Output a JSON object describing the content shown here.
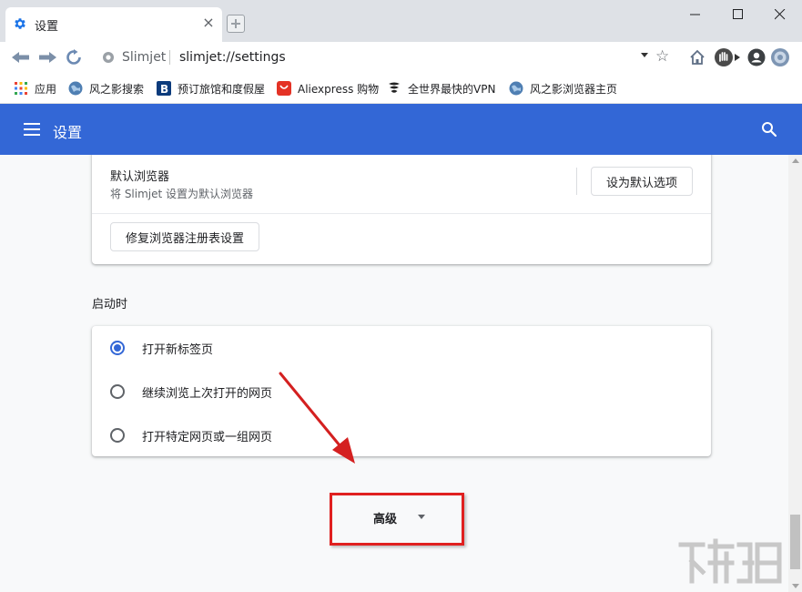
{
  "tab": {
    "title": "设置",
    "icon": "gear-icon"
  },
  "window_controls": [
    "minimize-icon",
    "maximize-icon",
    "close-icon"
  ],
  "omnibox": {
    "brand": "Slimjet",
    "url": "slimjet://settings"
  },
  "bookmarks": [
    {
      "label": "应用",
      "icon": "apps-grid-icon"
    },
    {
      "label": "风之影搜索",
      "icon": "globe-icon"
    },
    {
      "label": "预订旅馆和度假屋",
      "icon": "booking-icon"
    },
    {
      "label": "Aliexpress 购物",
      "icon": "aliexpress-icon"
    },
    {
      "label": "全世界最快的VPN",
      "icon": "vpn-icon"
    },
    {
      "label": "风之影浏览器主页",
      "icon": "globe-icon"
    }
  ],
  "header": {
    "title": "设置"
  },
  "default_browser": {
    "title": "默认浏览器",
    "subtitle": "将 Slimjet 设置为默认浏览器",
    "set_default_button": "设为默认选项",
    "repair_button": "修复浏览器注册表设置"
  },
  "startup": {
    "title": "启动时",
    "options": [
      {
        "label": "打开新标签页",
        "checked": true
      },
      {
        "label": "继续浏览上次打开的网页",
        "checked": false
      },
      {
        "label": "打开特定网页或一组网页",
        "checked": false
      }
    ]
  },
  "advanced": {
    "label": "高级"
  },
  "colors": {
    "accent": "#3367d6",
    "annotation": "#e02020"
  }
}
